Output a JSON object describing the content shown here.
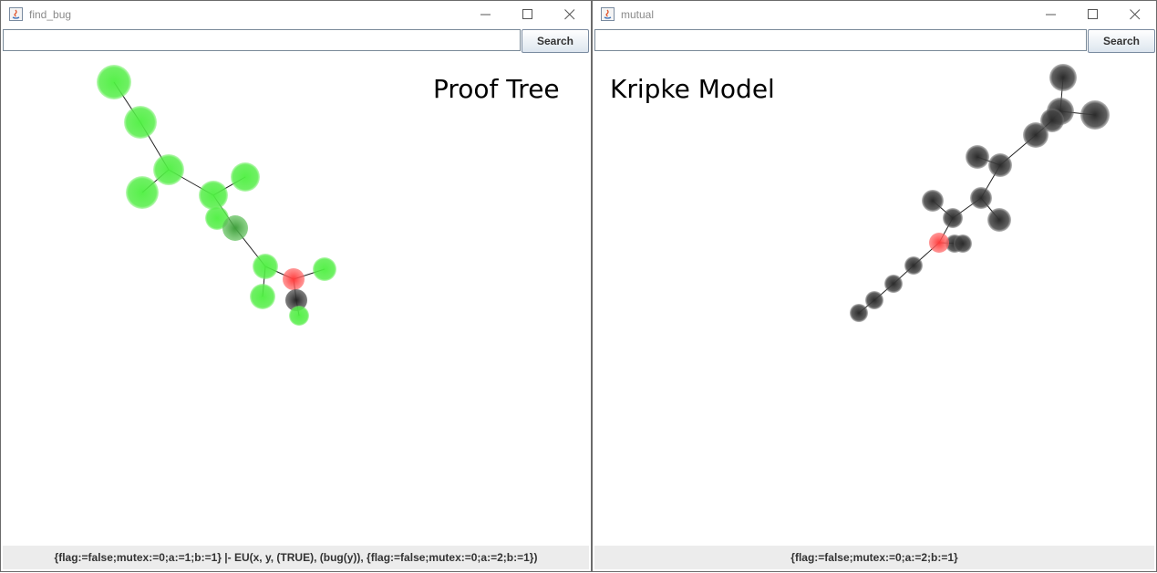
{
  "windows": [
    {
      "title": "find_bug",
      "search": {
        "value": "",
        "button_label": "Search"
      },
      "overlay_label": "Proof Tree",
      "status": "{flag:=false;mutex:=0;a:=1;b:=1} |- EU(x, y, (TRUE), (bug(y)), {flag:=false;mutex:=0;a:=2;b:=1})",
      "controls": [
        "minimize-icon",
        "maximize-icon",
        "close-icon"
      ],
      "node_colors": {
        "proved": "#44e83a",
        "current": "#ff4040",
        "dark": "#2a2a2a"
      }
    },
    {
      "title": "mutual",
      "search": {
        "value": "",
        "button_label": "Search"
      },
      "overlay_label": "Kripke Model",
      "status": "{flag:=false;mutex:=0;a:=2;b:=1}",
      "controls": [
        "minimize-icon",
        "maximize-icon",
        "close-icon"
      ],
      "node_colors": {
        "state": "#2a2a2a",
        "current": "#ff4040"
      }
    }
  ]
}
